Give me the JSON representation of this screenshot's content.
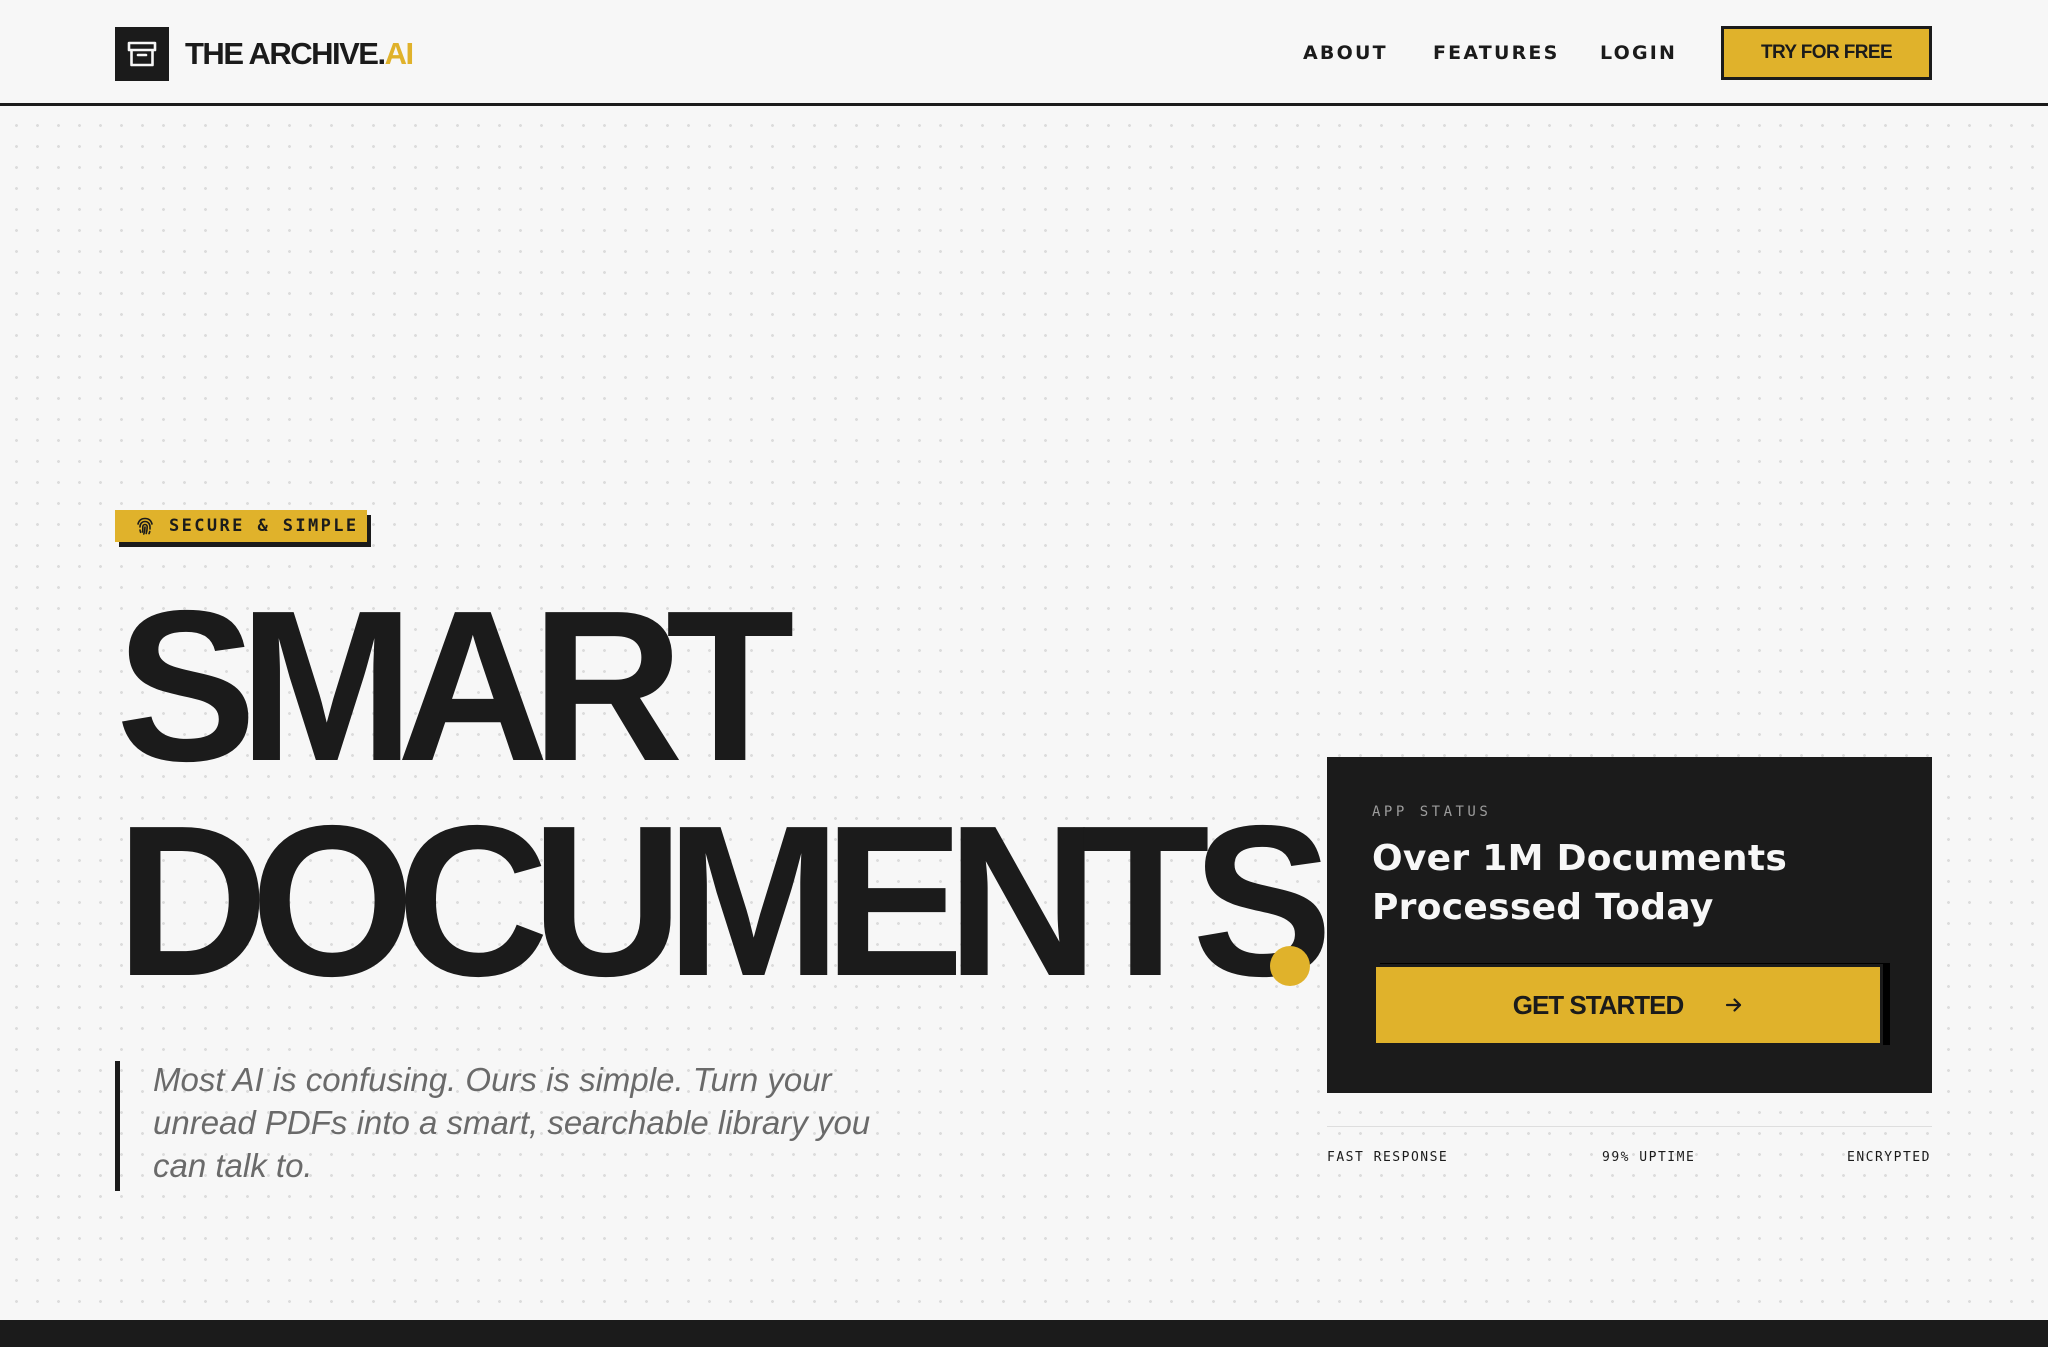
{
  "brand": {
    "name": "THE ARCHIVE.",
    "accent": "AI",
    "logo_icon": "archive-box-icon"
  },
  "nav": {
    "links": [
      "ABOUT",
      "FEATURES",
      "LOGIN"
    ],
    "cta_label": "TRY FOR FREE"
  },
  "hero": {
    "badge": {
      "icon": "fingerprint-icon",
      "label": "SECURE & SIMPLE"
    },
    "headline_line1": "SMART",
    "headline_line2": "DOCUMENTS",
    "description": "Most AI is confusing. Ours is simple. Turn your unread PDFs into a smart, searchable library you can talk to."
  },
  "status_card": {
    "label": "APP STATUS",
    "title": "Over 1M Documents Processed Today",
    "button_label": "GET STARTED",
    "button_icon": "arrow-right-icon"
  },
  "stats": [
    "FAST RESPONSE",
    "99% UPTIME",
    "ENCRYPTED"
  ],
  "colors": {
    "accent": "#e0b22b",
    "dark": "#1b1b1b",
    "background": "#f7f7f7"
  }
}
